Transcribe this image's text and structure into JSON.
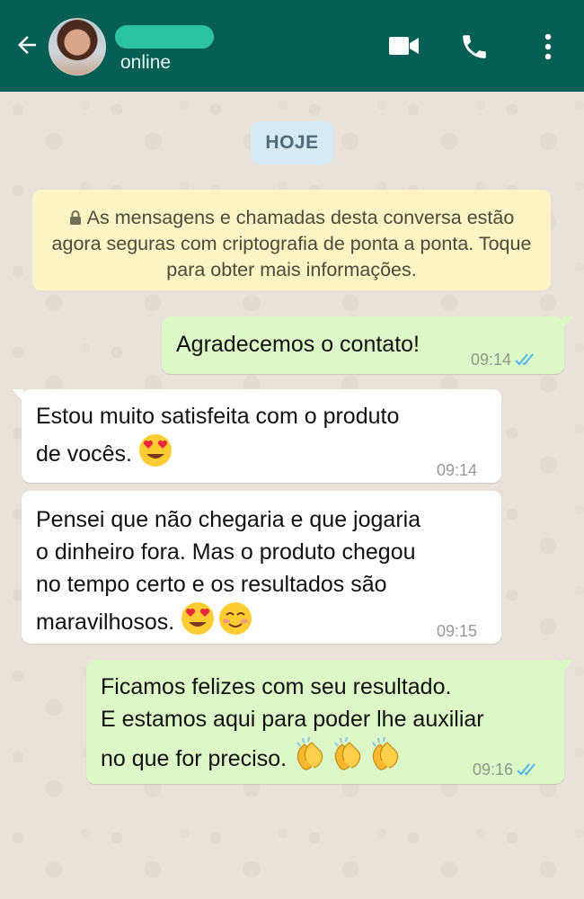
{
  "header": {
    "status": "online",
    "icons": [
      "back-arrow-icon",
      "video-call-icon",
      "phone-icon",
      "more-vert-icon"
    ],
    "color": "#075e54"
  },
  "chat": {
    "date_label": "HOJE",
    "encryption_notice": "As mensagens e chamadas desta conversa estão agora seguras com criptografia de ponta a ponta. Toque para obter mais informações.",
    "messages": [
      {
        "direction": "outgoing",
        "text": "Agradecemos o contato!",
        "time": "09:14",
        "read": true
      },
      {
        "direction": "incoming",
        "text": "Estou muito satisfeita com o produto\nde vocês.",
        "emoji": [
          "heart-eyes"
        ],
        "time": "09:14"
      },
      {
        "direction": "incoming",
        "text": "Pensei que não chegaria e que jogaria\no dinheiro fora. Mas o produto chegou\nno tempo certo e os resultados são\nmaravilhosos.",
        "emoji": [
          "heart-eyes",
          "smiling-blush"
        ],
        "time": "09:15"
      },
      {
        "direction": "outgoing",
        "text": "Ficamos felizes com seu resultado.\nE estamos aqui para poder lhe auxiliar\nno que for preciso.",
        "emoji": [
          "clapping-hands",
          "clapping-hands",
          "clapping-hands"
        ],
        "time": "09:16",
        "read": true
      }
    ]
  },
  "colors": {
    "outgoing_bubble": "#dcf8c6",
    "incoming_bubble": "#ffffff",
    "read_ticks": "#4fb6ec",
    "notice_bg": "#fcf4c4"
  }
}
